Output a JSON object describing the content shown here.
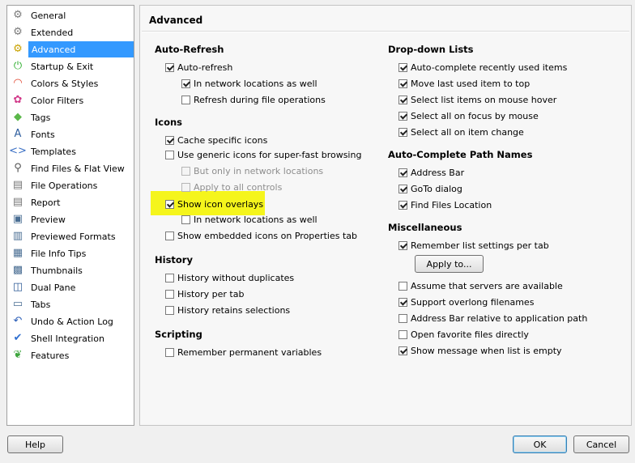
{
  "sidebar": {
    "items": [
      {
        "label": "General",
        "icon": "gear-icon",
        "glyph": "⚙",
        "color": "#7a7a7a"
      },
      {
        "label": "Extended",
        "icon": "gear-icon",
        "glyph": "⚙",
        "color": "#7a7a7a"
      },
      {
        "label": "Advanced",
        "icon": "gear-icon",
        "glyph": "⚙",
        "color": "#c9a200",
        "selected": true
      },
      {
        "label": "Startup & Exit",
        "icon": "power-icon",
        "glyph": "⏻",
        "color": "#2fae2f"
      },
      {
        "label": "Colors & Styles",
        "icon": "rainbow-icon",
        "glyph": "◠",
        "color": "#e0402a"
      },
      {
        "label": "Color Filters",
        "icon": "color-filter-icon",
        "glyph": "✿",
        "color": "#d23a8a"
      },
      {
        "label": "Tags",
        "icon": "tag-icon",
        "glyph": "◆",
        "color": "#5bb84a"
      },
      {
        "label": "Fonts",
        "icon": "font-icon",
        "glyph": "A",
        "color": "#2f5f9e"
      },
      {
        "label": "Templates",
        "icon": "template-icon",
        "glyph": "<>",
        "color": "#3a6fc4"
      },
      {
        "label": "Find Files & Flat View",
        "icon": "magnifier-icon",
        "glyph": "⚲",
        "color": "#555"
      },
      {
        "label": "File Operations",
        "icon": "file-icon",
        "glyph": "▤",
        "color": "#777"
      },
      {
        "label": "Report",
        "icon": "report-icon",
        "glyph": "▤",
        "color": "#777"
      },
      {
        "label": "Preview",
        "icon": "preview-icon",
        "glyph": "▣",
        "color": "#4a6e93"
      },
      {
        "label": "Previewed Formats",
        "icon": "formats-icon",
        "glyph": "▥",
        "color": "#4a6e93"
      },
      {
        "label": "File Info Tips",
        "icon": "info-tips-icon",
        "glyph": "▦",
        "color": "#4a6e93"
      },
      {
        "label": "Thumbnails",
        "icon": "thumbnails-icon",
        "glyph": "▩",
        "color": "#4a6e93"
      },
      {
        "label": "Dual Pane",
        "icon": "dual-pane-icon",
        "glyph": "◫",
        "color": "#2c5a96"
      },
      {
        "label": "Tabs",
        "icon": "tabs-icon",
        "glyph": "▭",
        "color": "#4a6e93"
      },
      {
        "label": "Undo & Action Log",
        "icon": "undo-icon",
        "glyph": "↶",
        "color": "#2c5fb8"
      },
      {
        "label": "Shell Integration",
        "icon": "checkmark-icon",
        "glyph": "✔",
        "color": "#2f6fd0"
      },
      {
        "label": "Features",
        "icon": "leaf-icon",
        "glyph": "❦",
        "color": "#3da53d"
      }
    ]
  },
  "panel": {
    "title": "Advanced"
  },
  "sections": {
    "auto_refresh": "Auto-Refresh",
    "icons": "Icons",
    "history": "History",
    "scripting": "Scripting",
    "dropdown": "Drop-down Lists",
    "autocomplete": "Auto-Complete Path Names",
    "misc": "Miscellaneous"
  },
  "checkboxes": [
    {
      "label": "Auto-refresh",
      "checked": true
    },
    {
      "label": "In network locations as well",
      "checked": true
    },
    {
      "label": "Refresh during file operations",
      "checked": false
    },
    {
      "label": "Cache specific icons",
      "checked": true
    },
    {
      "label": "Use generic icons for super-fast browsing",
      "checked": false
    },
    {
      "label": "But only in network locations",
      "checked": false,
      "disabled": true
    },
    {
      "label": "Apply to all controls",
      "checked": false,
      "disabled": true
    },
    {
      "label": "Show icon overlays",
      "checked": true
    },
    {
      "label": "In network locations as well",
      "checked": false
    },
    {
      "label": "Show embedded icons on Properties tab",
      "checked": false
    },
    {
      "label": "History without duplicates",
      "checked": false
    },
    {
      "label": "History per tab",
      "checked": false
    },
    {
      "label": "History retains selections",
      "checked": false
    },
    {
      "label": "Remember permanent variables",
      "checked": false
    },
    {
      "label": "Auto-complete recently used items",
      "checked": true
    },
    {
      "label": "Move last used item to top",
      "checked": true
    },
    {
      "label": "Select list items on mouse hover",
      "checked": true
    },
    {
      "label": "Select all on focus by mouse",
      "checked": true
    },
    {
      "label": "Select all on item change",
      "checked": true
    },
    {
      "label": "Address Bar",
      "checked": true
    },
    {
      "label": "GoTo dialog",
      "checked": true
    },
    {
      "label": "Find Files Location",
      "checked": true
    },
    {
      "label": "Remember list settings per tab",
      "checked": true
    },
    {
      "label": "Assume that servers are available",
      "checked": false
    },
    {
      "label": "Support overlong filenames",
      "checked": true
    },
    {
      "label": "Address Bar relative to application path",
      "checked": false
    },
    {
      "label": "Open favorite files directly",
      "checked": false
    },
    {
      "label": "Show message when list is empty",
      "checked": true
    }
  ],
  "buttons": {
    "apply_to": "Apply to...",
    "help": "Help",
    "ok": "OK",
    "cancel": "Cancel"
  },
  "highlight_color": "#f5f51c"
}
